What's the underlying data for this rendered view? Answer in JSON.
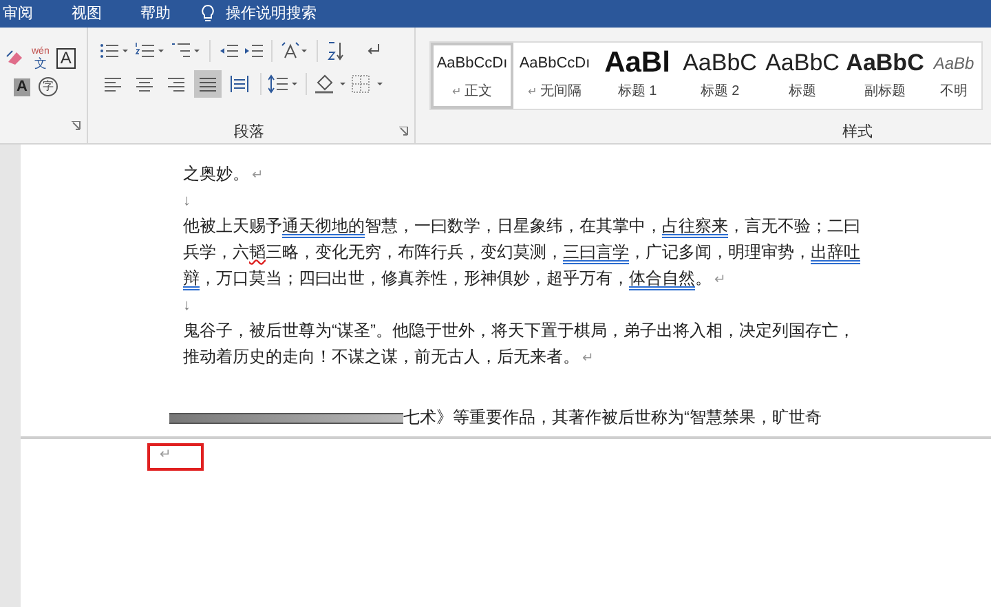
{
  "menu_tabs": [
    {
      "label": "审阅"
    },
    {
      "label": "视图"
    },
    {
      "label": "帮助"
    }
  ],
  "tell_me": {
    "placeholder": "操作说明搜索"
  },
  "font_group": {
    "phonetic_top": "wén",
    "phonetic_bottom": "文",
    "border_char": "A",
    "shading_char": "A",
    "enclose_char": "字"
  },
  "paragraph_group": {
    "label": "段落",
    "alignments": [
      {
        "kind": "left",
        "selected": false
      },
      {
        "kind": "center",
        "selected": false
      },
      {
        "kind": "right",
        "selected": false
      },
      {
        "kind": "justify",
        "selected": true
      },
      {
        "kind": "distributed",
        "selected": false
      }
    ]
  },
  "styles_group": {
    "label": "样式",
    "styles": [
      {
        "sample": "AaBbCcDı",
        "label": "正文",
        "mark": "↵",
        "kind": "normal",
        "selected": true
      },
      {
        "sample": "AaBbCcDı",
        "label": "无间隔",
        "mark": "↵",
        "kind": "normal",
        "selected": false
      },
      {
        "sample": "AaBl",
        "label": "标题 1",
        "kind": "heading1",
        "selected": false
      },
      {
        "sample": "AaBbC",
        "label": "标题 2",
        "kind": "heading2",
        "selected": false
      },
      {
        "sample": "AaBbC",
        "label": "标题",
        "kind": "title",
        "selected": false
      },
      {
        "sample": "AaBbC",
        "label": "副标题",
        "kind": "subtitle",
        "selected": false
      },
      {
        "sample": "AaBb",
        "label": "不明",
        "kind": "emphasis",
        "selected": false
      }
    ]
  },
  "document": {
    "paragraphs": [
      {
        "kind": "text",
        "segments": [
          {
            "text": "之奥妙。",
            "kind": "plain"
          }
        ],
        "mark": "↵"
      },
      {
        "kind": "break",
        "mark": "↓"
      },
      {
        "kind": "text",
        "segments": [
          {
            "text": "他被上天赐予",
            "kind": "plain"
          },
          {
            "text": "通天彻地的",
            "kind": "grammar"
          },
          {
            "text": "智慧，一曰数学，日星象纬，在其掌中，",
            "kind": "plain"
          },
          {
            "text": "占往察来",
            "kind": "grammar"
          },
          {
            "text": "，言无不验；二曰兵学，六",
            "kind": "plain"
          },
          {
            "text": "韬",
            "kind": "spelling"
          },
          {
            "text": "三略，变化无穷，布阵行兵，变幻莫测，",
            "kind": "plain"
          },
          {
            "text": "三曰言学",
            "kind": "grammar"
          },
          {
            "text": "，广记多闻，明理审势，",
            "kind": "plain"
          },
          {
            "text": "出辞吐辩",
            "kind": "grammar"
          },
          {
            "text": "，万口莫当；四曰出世，修真养性，形神俱妙，超乎万有，",
            "kind": "plain"
          },
          {
            "text": "体合自然",
            "kind": "grammar"
          },
          {
            "text": "。",
            "kind": "plain"
          }
        ],
        "mark": "↵"
      },
      {
        "kind": "break",
        "mark": "↓"
      },
      {
        "kind": "text",
        "segments": [
          {
            "text": "鬼谷子，被后世尊为“谋圣”。他隐于世外，将天下置于棋局，弟子出将入相，决定列国存亡，推动着历史的走向！不谋之谋，前无古人，后无来者。",
            "kind": "plain"
          }
        ],
        "mark": "↵"
      },
      {
        "kind": "smeared",
        "segments": [
          {
            "text": "七术》等重要作品，其著作被后世称为“智慧禁果，旷世奇",
            "kind": "plain"
          }
        ]
      }
    ],
    "next_page_mark": "↵"
  }
}
